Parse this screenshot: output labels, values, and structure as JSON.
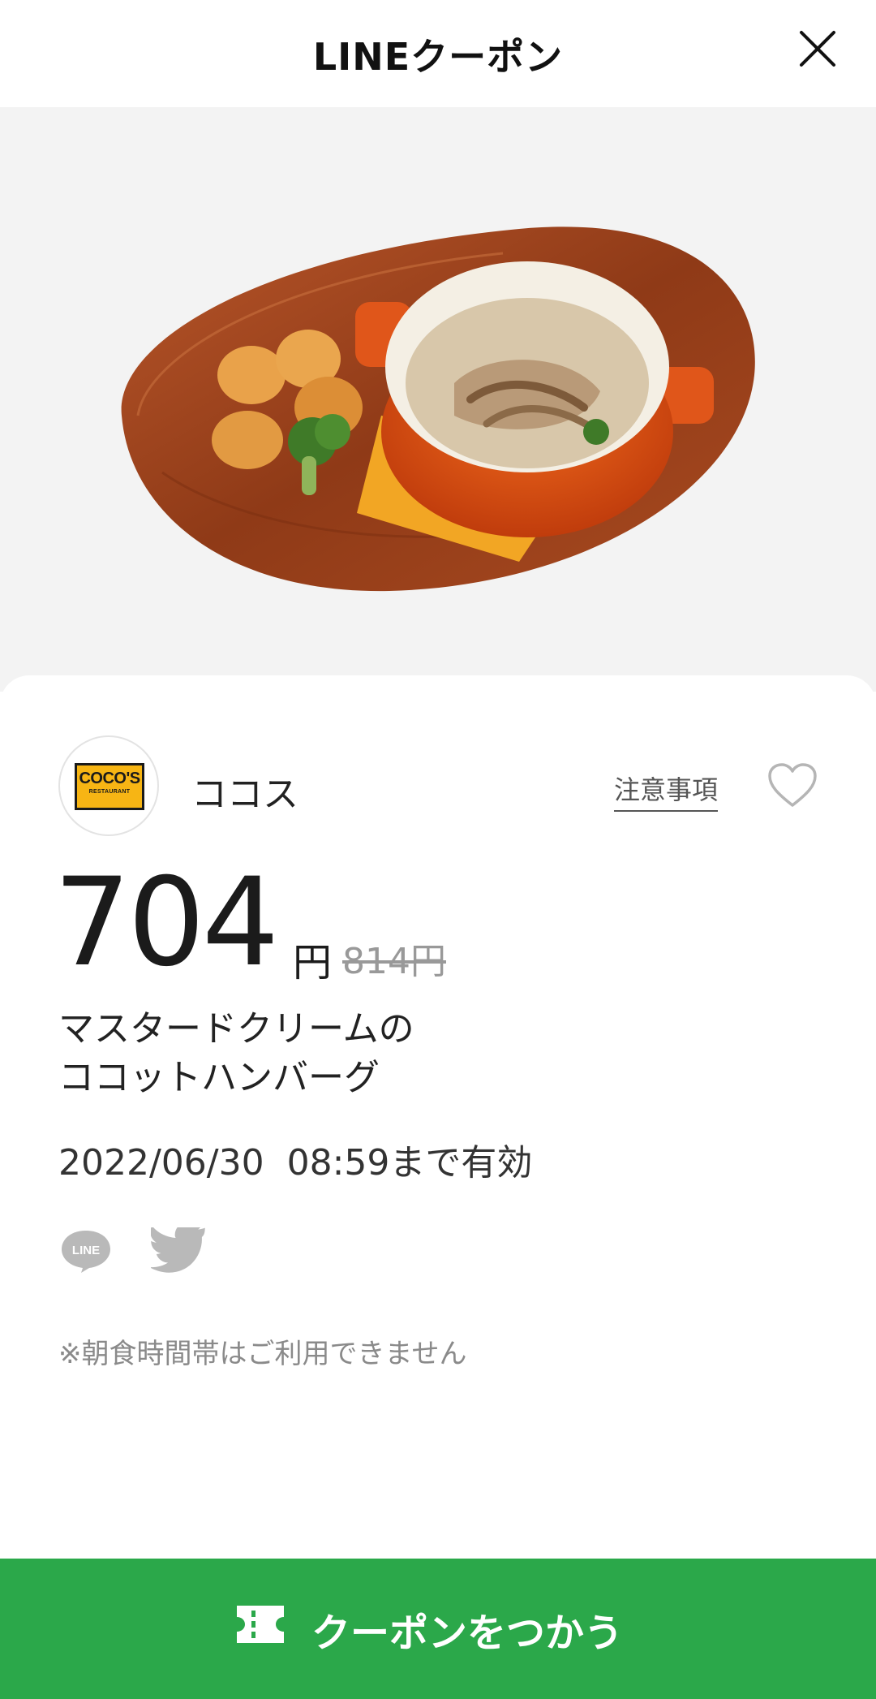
{
  "header": {
    "title": "LINEクーポン",
    "close_icon": "close-icon"
  },
  "hero": {
    "alt": ""
  },
  "shop": {
    "logo_text": "COCO'S",
    "logo_subtext": "RESTAURANT",
    "name": "ココス",
    "notes_link": "注意事項",
    "favorite_icon": "heart-outline-icon"
  },
  "price": {
    "value": "704",
    "unit": "円",
    "original": "814円"
  },
  "item": {
    "name_line1": "マスタードクリームの",
    "name_line2": "ココットハンバーグ"
  },
  "validity": "2022/06/30  08:59まで有効",
  "share": {
    "line_icon": "line-share-icon",
    "line_text": "LINE",
    "twitter_icon": "twitter-icon"
  },
  "note": "※朝食時間帯はご利用できません",
  "cta": {
    "label": "クーポンをつかう",
    "icon": "ticket-icon"
  },
  "colors": {
    "accent": "#2ba84a",
    "background": "#ffffff",
    "hero_bg": "#f3f3f3"
  }
}
